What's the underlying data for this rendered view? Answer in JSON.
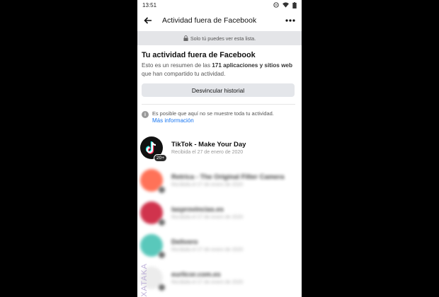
{
  "status_bar": {
    "time": "13:51"
  },
  "app_bar": {
    "title": "Actividad fuera de Facebook"
  },
  "notice": {
    "text": "Solo tú puedes ver esta lista."
  },
  "summary": {
    "title": "Tu actividad fuera de Facebook",
    "desc_pre": "Esto es un resumen de las ",
    "desc_bold": "171 aplicaciones y sitios web",
    "desc_post": " que han compartido tu actividad.",
    "button_label": "Desvincular historial"
  },
  "info": {
    "text": "Es posible que aquí no se muestre toda tu actividad.",
    "link": "Más información"
  },
  "apps": [
    {
      "name": "TikTok - Make Your Day",
      "date": "Recibida el 27 de enero de 2020",
      "badge": "20+",
      "color": "#111111"
    },
    {
      "name": "Retrica - The Original Filter Camera",
      "date": "Recibida el 27 de enero de 2020",
      "badge": "",
      "color": "#ff5a3c"
    },
    {
      "name": "lasprovincias.es",
      "date": "Recibida el 27 de enero de 2020",
      "badge": "",
      "color": "#c8102e"
    },
    {
      "name": "Delivero",
      "date": "Recibida el 27 de enero de 2020",
      "badge": "",
      "color": "#3dbfb0"
    },
    {
      "name": "eurlicor.com.es",
      "date": "Recibida el 27 de enero de 2020",
      "badge": "",
      "color": "#e9e9e9"
    }
  ],
  "watermark": "XATAKA",
  "colors": {
    "link": "#1876f2",
    "notice_bg": "#e4e5e8"
  }
}
